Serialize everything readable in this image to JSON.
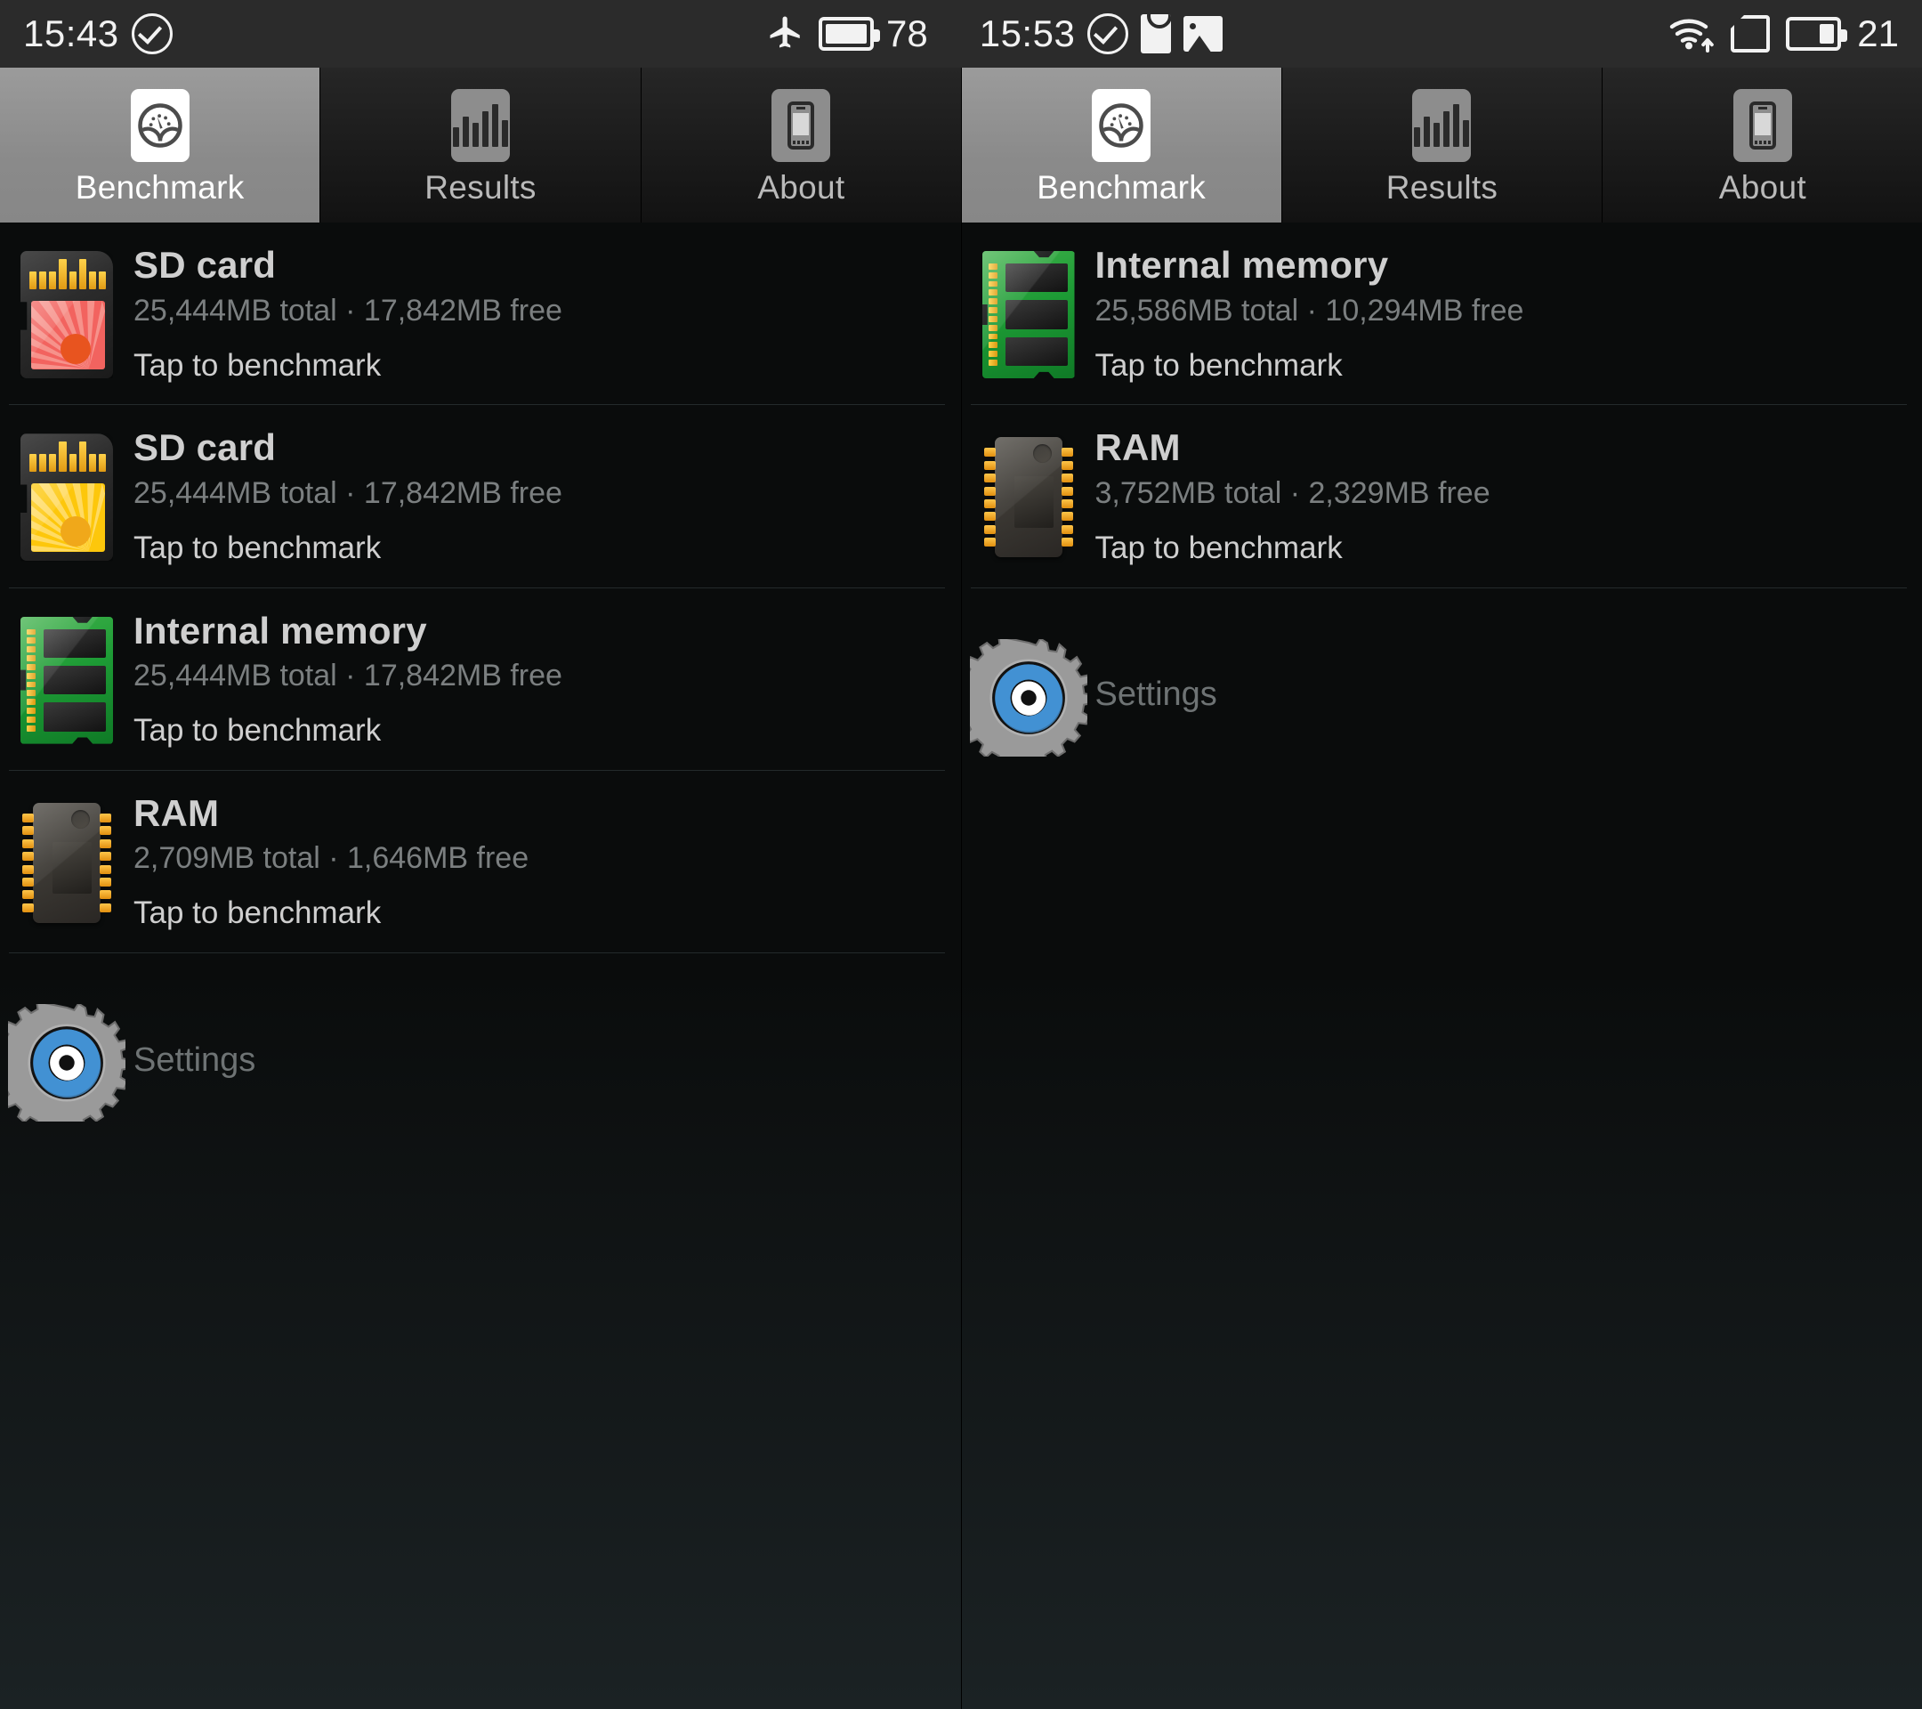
{
  "status_bar": {
    "left_time": "15:43",
    "left_icons": [
      "check-circle-icon",
      "airplane-icon",
      "battery-icon"
    ],
    "left_battery": "78",
    "right_time": "15:53",
    "right_icons": [
      "check-circle-icon",
      "bag-icon",
      "photo-icon",
      "wifi-icon",
      "sim-card-icon",
      "battery-icon"
    ],
    "right_battery": "21"
  },
  "tabs": [
    {
      "label": "Benchmark",
      "icon": "gauge-icon",
      "active": true
    },
    {
      "label": "Results",
      "icon": "bar-chart-icon",
      "active": false
    },
    {
      "label": "About",
      "icon": "phone-icon",
      "active": false
    }
  ],
  "left_panel": {
    "rows": [
      {
        "title": "SD card",
        "subtitle": "25,444MB total · 17,842MB free",
        "action": "Tap to benchmark",
        "icon": "sd-card-red-icon"
      },
      {
        "title": "SD card",
        "subtitle": "25,444MB total · 17,842MB free",
        "action": "Tap to benchmark",
        "icon": "sd-card-yellow-icon"
      },
      {
        "title": "Internal memory",
        "subtitle": "25,444MB total · 17,842MB free",
        "action": "Tap to benchmark",
        "icon": "memory-module-icon"
      },
      {
        "title": "RAM",
        "subtitle": "2,709MB total · 1,646MB free",
        "action": "Tap to benchmark",
        "icon": "ram-chip-icon"
      }
    ],
    "settings": {
      "label": "Settings",
      "icon": "gear-icon"
    }
  },
  "right_panel": {
    "rows": [
      {
        "title": "Internal memory",
        "subtitle": "25,586MB total · 10,294MB free",
        "action": "Tap to benchmark",
        "icon": "memory-module-icon"
      },
      {
        "title": "RAM",
        "subtitle": "3,752MB total · 2,329MB free",
        "action": "Tap to benchmark",
        "icon": "ram-chip-icon"
      }
    ],
    "settings": {
      "label": "Settings",
      "icon": "gear-icon"
    }
  },
  "colors": {
    "status_bar_bg": "#2b2b2b",
    "tab_active_bg": "#8d8d8d",
    "content_bg": "#0a0c0c",
    "title_text": "#cfcfcf",
    "sub_text": "#7b7f80",
    "sd_red": "#f2635f",
    "sd_yellow": "#fdc70b",
    "memory_green": "#1d9b35",
    "gear_blue": "#2d7fc4"
  }
}
